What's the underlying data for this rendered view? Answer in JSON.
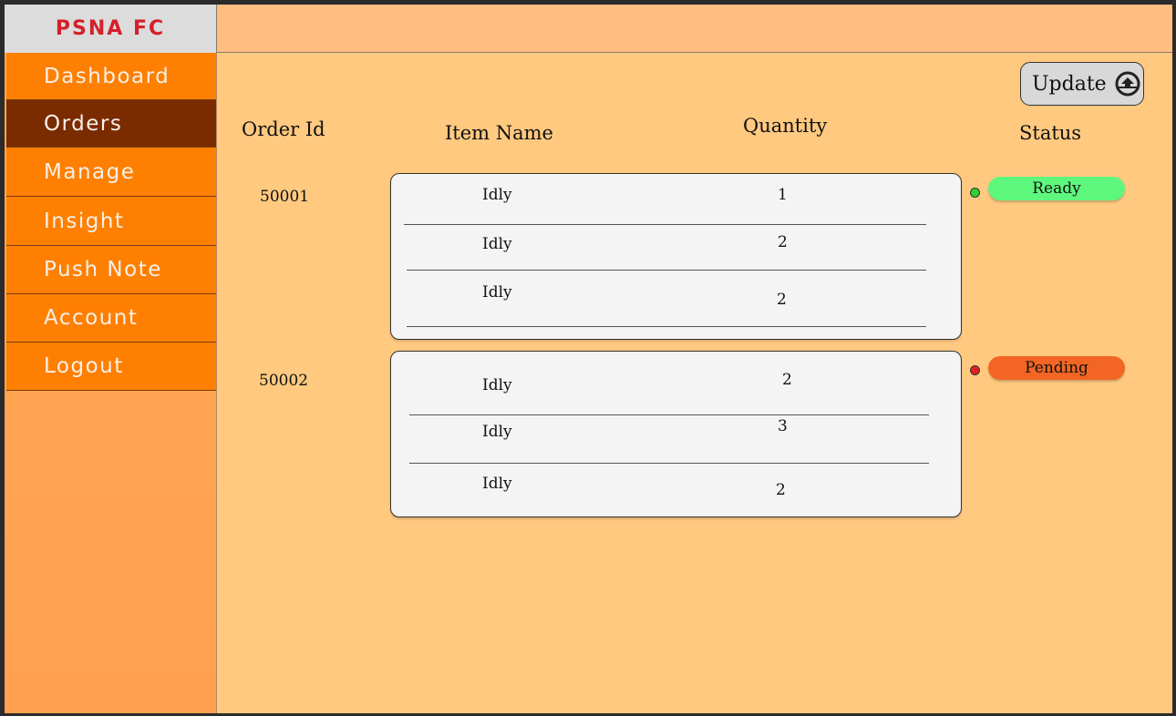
{
  "brand": {
    "title": "PSNA FC"
  },
  "sidebar": {
    "items": [
      {
        "label": "Dashboard"
      },
      {
        "label": "Orders"
      },
      {
        "label": "Manage"
      },
      {
        "label": "Insight"
      },
      {
        "label": "Push Note"
      },
      {
        "label": "Account"
      },
      {
        "label": "Logout"
      }
    ],
    "active": "Orders"
  },
  "main": {
    "update_label": "Update",
    "update_icon": "refresh-icon",
    "columns": {
      "order_id": "Order Id",
      "item_name": "Item Name",
      "quantity": "Quantity",
      "status": "Status"
    },
    "orders": [
      {
        "id": "50001",
        "items": [
          {
            "name": "Idly",
            "qty": "1"
          },
          {
            "name": "Idly",
            "qty": "2"
          },
          {
            "name": "Idly",
            "qty": "2"
          }
        ],
        "status": "Ready",
        "status_color": "#5ef77e",
        "dot_color": "#2fd02f"
      },
      {
        "id": "50002",
        "items": [
          {
            "name": "Idly",
            "qty": "2"
          },
          {
            "name": "Idly",
            "qty": "3"
          },
          {
            "name": "Idly",
            "qty": "2"
          }
        ],
        "status": "Pending",
        "status_color": "#f26524",
        "dot_color": "#e02020"
      }
    ]
  },
  "colors": {
    "sidebar_item": "#ff7f00",
    "sidebar_active": "#7a2b00",
    "topbar": "#ffbd80",
    "main_bg": "#ffc980",
    "brand_text": "#d4202a"
  }
}
